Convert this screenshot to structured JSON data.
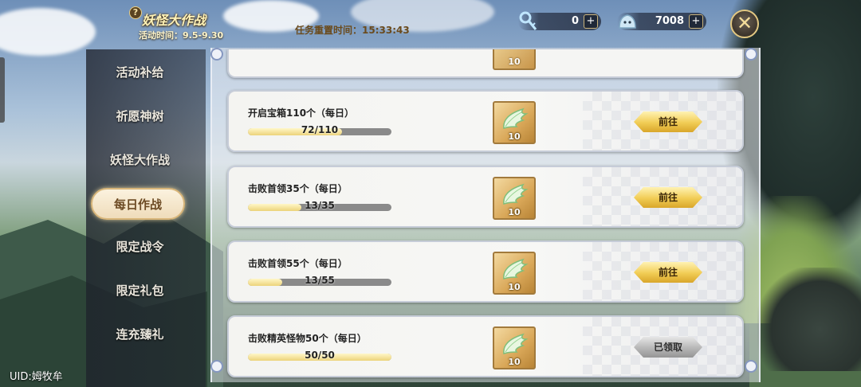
{
  "header": {
    "event_title": "妖怪大作战",
    "event_time": "活动时间：9.5-9.30",
    "reset_time": "任务重置时间：15:33:43"
  },
  "currencies": [
    {
      "icon": "key-icon",
      "amount": "0"
    },
    {
      "icon": "slime-icon",
      "amount": "7008"
    }
  ],
  "sidebar": {
    "items": [
      {
        "label": "活动补给",
        "active": false
      },
      {
        "label": "祈愿神树",
        "active": false
      },
      {
        "label": "妖怪大作战",
        "active": false
      },
      {
        "label": "每日作战",
        "active": true
      },
      {
        "label": "限定战令",
        "active": false
      },
      {
        "label": "限定礼包",
        "active": false
      },
      {
        "label": "连充臻礼",
        "active": false
      }
    ]
  },
  "uid": "UID:姆牧牟",
  "tasks": {
    "partial_reward_qty": "10",
    "items": [
      {
        "title": "开启宝箱110个（每日）",
        "progress_text": "72/110",
        "current": 72,
        "total": 110,
        "reward_qty": "10",
        "button": "前往",
        "claimed": false
      },
      {
        "title": "击败首领35个（每日）",
        "progress_text": "13/35",
        "current": 13,
        "total": 35,
        "reward_qty": "10",
        "button": "前往",
        "claimed": false
      },
      {
        "title": "击败首领55个（每日）",
        "progress_text": "13/55",
        "current": 13,
        "total": 55,
        "reward_qty": "10",
        "button": "前往",
        "claimed": false
      },
      {
        "title": "击败精英怪物50个（每日）",
        "progress_text": "50/50",
        "current": 50,
        "total": 50,
        "reward_qty": "10",
        "button": "已领取",
        "claimed": true
      }
    ]
  },
  "colors": {
    "gold_button": "#f1cc54",
    "claimed_button": "#b6b6b6",
    "progress_fill": "#ecd37a",
    "active_tab": "#efdcbb"
  }
}
